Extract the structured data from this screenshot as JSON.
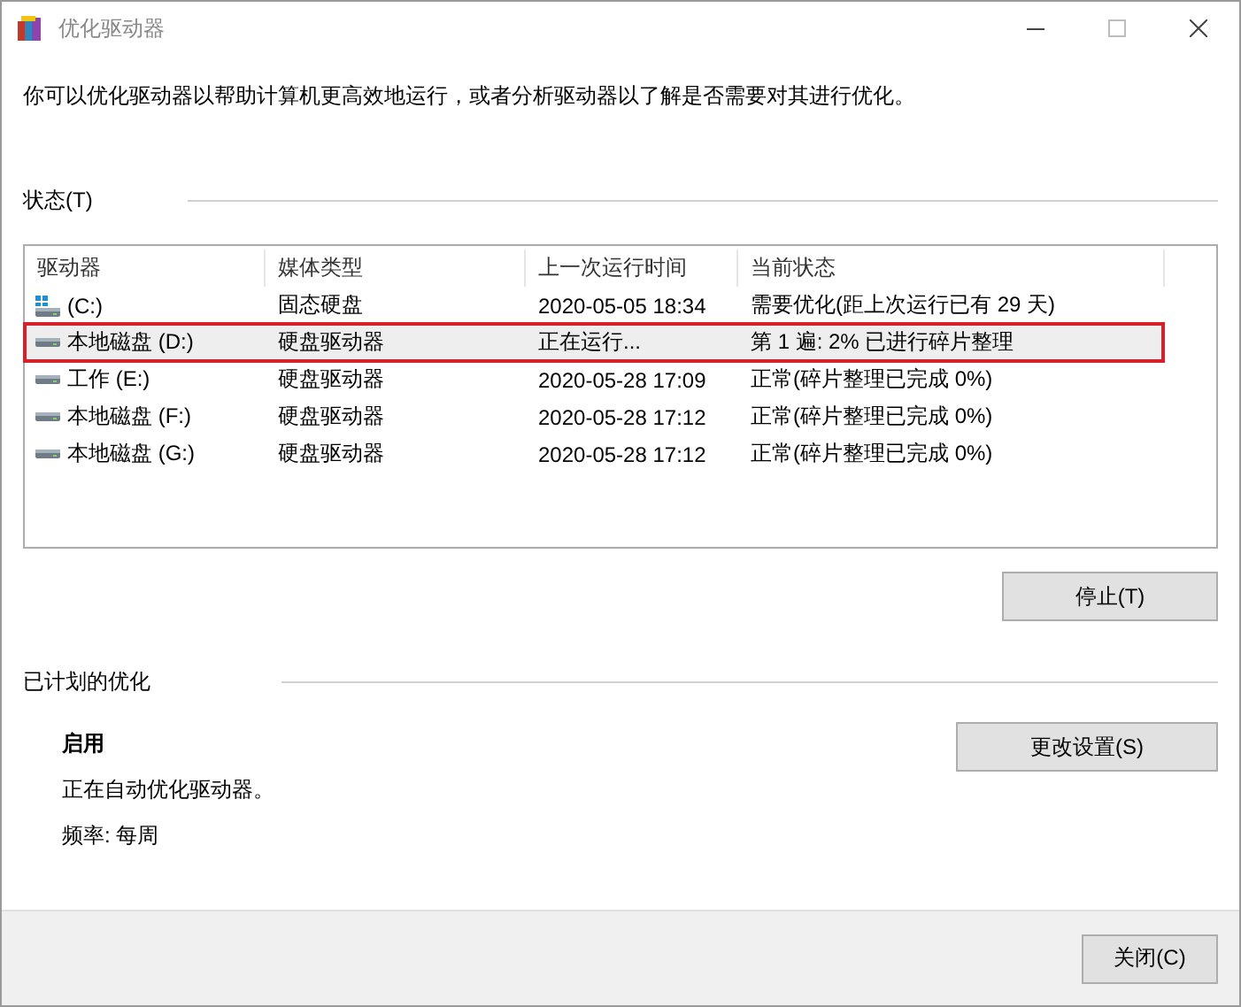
{
  "window": {
    "title": "优化驱动器",
    "controls": [
      {
        "kind": "minimize",
        "disabled": false
      },
      {
        "kind": "maximize",
        "disabled": true
      },
      {
        "kind": "close",
        "disabled": false
      }
    ]
  },
  "description": "你可以优化驱动器以帮助计算机更高效地运行，或者分析驱动器以了解是否需要对其进行优化。",
  "status": {
    "label": "状态(T)",
    "table": {
      "columns": [
        "驱动器",
        "媒体类型",
        "上一次运行时间",
        "当前状态"
      ],
      "rows": [
        {
          "kind": "system",
          "drive": "(C:)",
          "media": "固态硬盘",
          "last_run": "2020-05-05 18:34",
          "state": "需要优化(距上次运行已有 29 天)",
          "selected": false,
          "annotated": false
        },
        {
          "kind": "disk",
          "drive": "本地磁盘 (D:)",
          "media": "硬盘驱动器",
          "last_run": "正在运行...",
          "state": "第 1 遍: 2% 已进行碎片整理",
          "selected": true,
          "annotated": true
        },
        {
          "kind": "disk",
          "drive": "工作 (E:)",
          "media": "硬盘驱动器",
          "last_run": "2020-05-28 17:09",
          "state": "正常(碎片整理已完成 0%)",
          "selected": false,
          "annotated": false
        },
        {
          "kind": "disk",
          "drive": "本地磁盘 (F:)",
          "media": "硬盘驱动器",
          "last_run": "2020-05-28 17:12",
          "state": "正常(碎片整理已完成 0%)",
          "selected": false,
          "annotated": false
        },
        {
          "kind": "disk",
          "drive": "本地磁盘 (G:)",
          "media": "硬盘驱动器",
          "last_run": "2020-05-28 17:12",
          "state": "正常(碎片整理已完成 0%)",
          "selected": false,
          "annotated": false
        }
      ]
    },
    "button": "停止(T)"
  },
  "scheduled": {
    "label": "已计划的优化",
    "state": "启用",
    "info": "正在自动优化驱动器。",
    "frequency": "频率: 每周",
    "button": "更改设置(S)"
  },
  "footer": {
    "button": "关闭(C)"
  }
}
